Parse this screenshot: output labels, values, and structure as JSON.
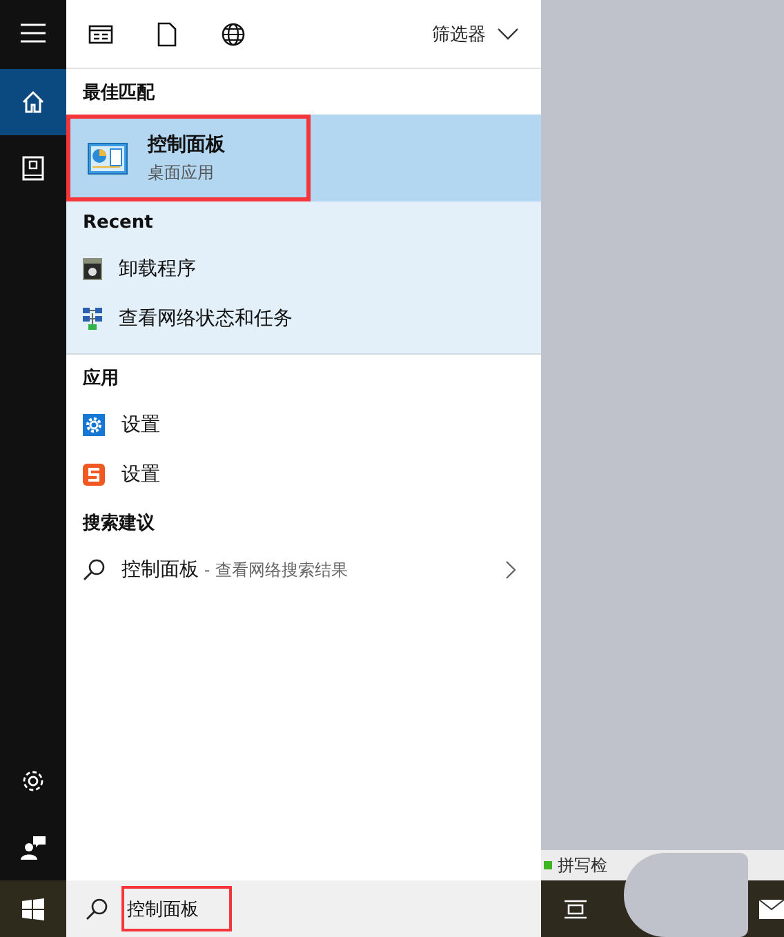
{
  "sidebar": {
    "items": [
      {
        "kind": "menu",
        "selected": false
      },
      {
        "kind": "home",
        "selected": true
      },
      {
        "kind": "notebook",
        "selected": false
      }
    ],
    "bottom_items": [
      {
        "kind": "settings",
        "selected": false
      },
      {
        "kind": "feedback",
        "selected": false
      }
    ]
  },
  "toolbar": {
    "icons": [
      {
        "kind": "document-list"
      },
      {
        "kind": "file"
      },
      {
        "kind": "globe"
      }
    ],
    "filter": "筛选器"
  },
  "best_match": {
    "heading": "最佳匹配",
    "item": {
      "title": "控制面板",
      "subtitle": "桌面应用",
      "highlighted": true
    }
  },
  "recent": {
    "heading": "Recent",
    "items": [
      {
        "kind": "uninstall",
        "label": "卸载程序"
      },
      {
        "kind": "network",
        "label": "查看网络状态和任务"
      }
    ]
  },
  "apps": {
    "heading": "应用",
    "items": [
      {
        "kind": "gear",
        "label": "设置"
      },
      {
        "kind": "sogou",
        "label": "设置"
      }
    ]
  },
  "suggestions": {
    "heading": "搜索建议",
    "items": [
      {
        "query": "控制面板",
        "hint": " - 查看网络搜索结果"
      }
    ]
  },
  "background_window": {
    "status_text": "拼写检"
  },
  "taskbar": {
    "search": {
      "value": "控制面板",
      "highlighted": true
    }
  }
}
